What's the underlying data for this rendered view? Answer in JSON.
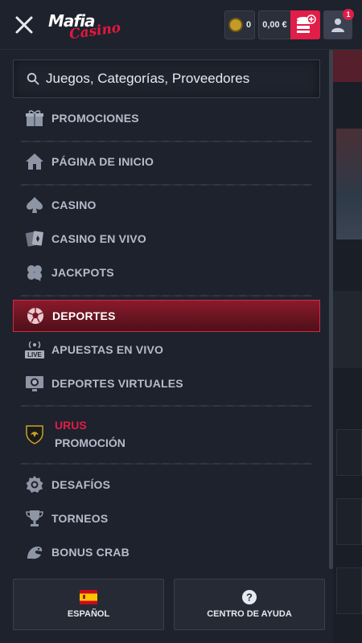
{
  "header": {
    "logo_top": "Mafia",
    "logo_bottom": "Casino",
    "coins": "0",
    "balance": "0,00 €",
    "notifications": "1"
  },
  "search": {
    "placeholder": "Juegos, Categorías, Proveedores"
  },
  "menu": {
    "promociones": "PROMOCIONES",
    "inicio": "PÁGINA DE INICIO",
    "casino": "CASINO",
    "casino_vivo": "CASINO EN VIVO",
    "jackpots": "JACKPOTS",
    "deportes": "DEPORTES",
    "apuestas_vivo": "APUESTAS EN VIVO",
    "deportes_virtuales": "DEPORTES VIRTUALES",
    "urus_title": "URUS",
    "urus_sub": "PROMOCIÓN",
    "desafios": "DESAFÍOS",
    "torneos": "TORNEOS",
    "bonus_crab": "BONUS CRAB"
  },
  "footer": {
    "language": "ESPAÑOL",
    "help": "CENTRO DE AYUDA"
  },
  "colors": {
    "accent": "#e11d48",
    "panel": "#1e222c",
    "text": "#b5bccb"
  }
}
